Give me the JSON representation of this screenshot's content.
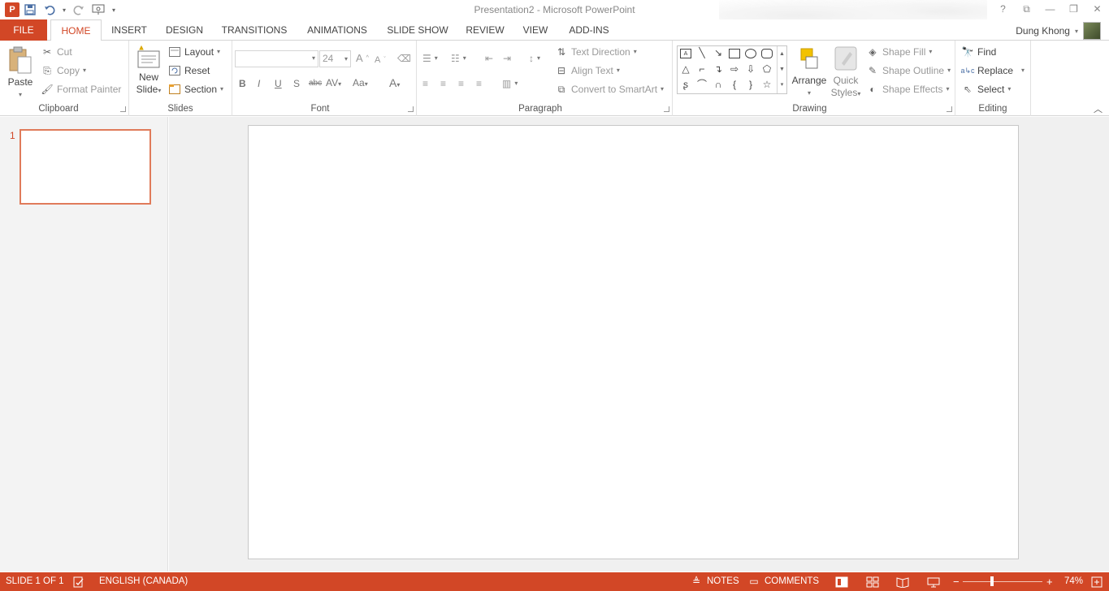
{
  "window": {
    "title": "Presentation2 - Microsoft PowerPoint",
    "app_logo": "P",
    "help": "?",
    "restore_ribbon": "⧉",
    "minimize": "—",
    "maximize": "❐",
    "close": "✕"
  },
  "qat": {
    "save_icon": "💾",
    "undo_icon": "↶",
    "redo_icon": "↺",
    "present_icon": "⊡",
    "more": "▾"
  },
  "tabs": [
    "FILE",
    "HOME",
    "INSERT",
    "DESIGN",
    "TRANSITIONS",
    "ANIMATIONS",
    "SLIDE SHOW",
    "REVIEW",
    "VIEW",
    "ADD-INS"
  ],
  "user": {
    "name": "Dung Khong",
    "caret": "▾"
  },
  "ribbon": {
    "clipboard": {
      "label": "Clipboard",
      "paste": "Paste",
      "cut": "Cut",
      "copy": "Copy",
      "format_painter": "Format Painter"
    },
    "slides": {
      "label": "Slides",
      "new_slide_1": "New",
      "new_slide_2": "Slide",
      "layout": "Layout",
      "reset": "Reset",
      "section": "Section"
    },
    "font": {
      "label": "Font",
      "size": "24",
      "bold": "B",
      "italic": "I",
      "underline": "U",
      "shadow": "S",
      "strike": "abc",
      "spacing": "AV",
      "case": "Aa",
      "color": "A",
      "grow": "A",
      "shrink": "A",
      "clear": "⌫"
    },
    "paragraph": {
      "label": "Paragraph",
      "text_direction": "Text Direction",
      "align_text": "Align Text",
      "convert_smartart": "Convert to SmartArt"
    },
    "drawing": {
      "label": "Drawing",
      "arrange": "Arrange",
      "quick_styles_1": "Quick",
      "quick_styles_2": "Styles",
      "shape_fill": "Shape Fill",
      "shape_outline": "Shape Outline",
      "shape_effects": "Shape Effects"
    },
    "editing": {
      "label": "Editing",
      "find": "Find",
      "replace": "Replace",
      "select": "Select"
    }
  },
  "slides_pane": {
    "slide_number": "1"
  },
  "status": {
    "slide_info": "SLIDE 1 OF 1",
    "language": "ENGLISH (CANADA)",
    "notes": "NOTES",
    "comments": "COMMENTS",
    "zoom_minus": "−",
    "zoom_plus": "+",
    "zoom": "74%"
  },
  "colors": {
    "accent": "#d24726"
  }
}
